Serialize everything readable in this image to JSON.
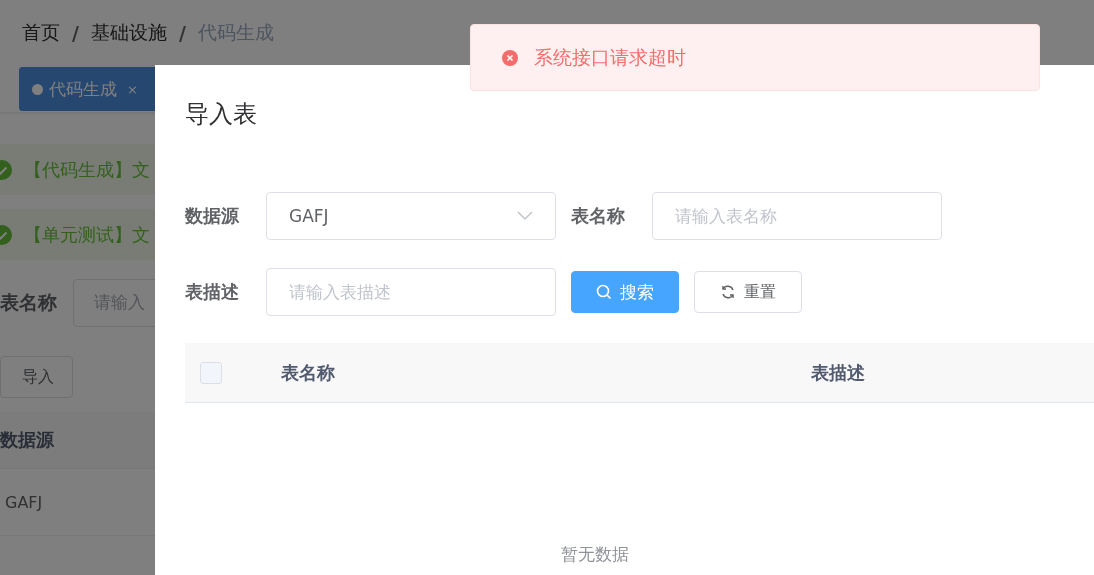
{
  "breadcrumb": {
    "separator": "/",
    "items": [
      {
        "label": "首页",
        "current": false
      },
      {
        "label": "基础设施",
        "current": false
      },
      {
        "label": "代码生成",
        "current": true
      }
    ]
  },
  "tabs": [
    {
      "label": "代码生成",
      "selected": true,
      "close": "×"
    }
  ],
  "alerts": [
    {
      "text": "【代码生成】文"
    },
    {
      "text": "【单元测试】文"
    }
  ],
  "filter": {
    "label": "表名称",
    "placeholder": "请输入"
  },
  "import_button": "导入",
  "table": {
    "columns": [
      "数据源"
    ],
    "rows": [
      [
        "GAFJ"
      ]
    ]
  },
  "dialog": {
    "title": "导入表",
    "fields": [
      {
        "kind": "select",
        "label": "数据源",
        "value": "GAFJ"
      },
      {
        "kind": "input",
        "label": "表名称",
        "placeholder": "请输入表名称"
      },
      {
        "kind": "input",
        "label": "表描述",
        "placeholder": "请输入表描述"
      }
    ],
    "buttons": [
      {
        "kind": "primary",
        "label": "搜索"
      },
      {
        "kind": "default",
        "label": "重置"
      }
    ],
    "table": {
      "select_all_checked": false,
      "columns": [
        "表名称",
        "表描述"
      ],
      "empty_text": "暂无数据"
    }
  },
  "toast": {
    "kind": "error",
    "message": "系统接口请求超时"
  }
}
